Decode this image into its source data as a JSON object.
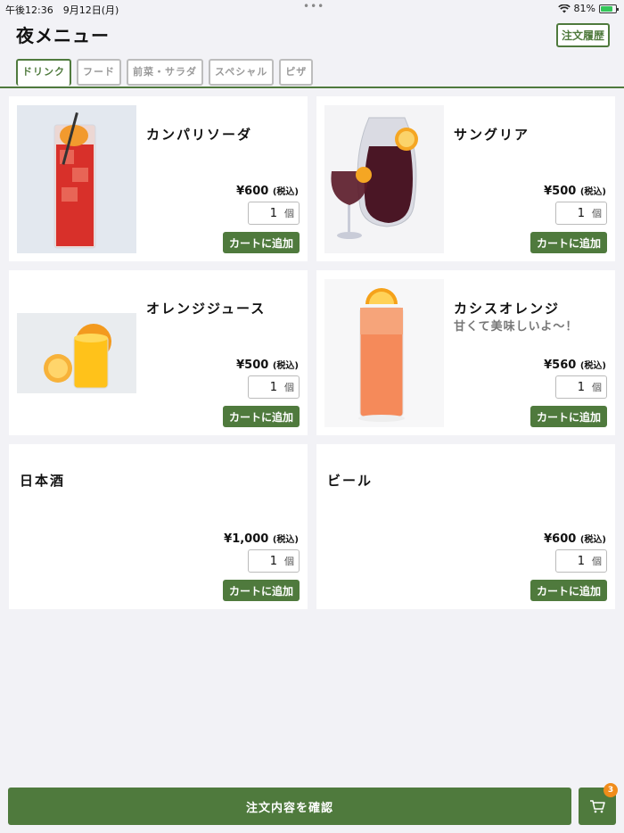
{
  "status_bar": {
    "time": "午後12:36　9月12日(月)",
    "battery": "81%",
    "dots": "•••"
  },
  "header": {
    "title": "夜メニュー",
    "history_label": "注文履歴"
  },
  "tabs": [
    {
      "label": "ドリンク",
      "active": true
    },
    {
      "label": "フード"
    },
    {
      "label": "前菜・サラダ"
    },
    {
      "label": "スペシャル"
    },
    {
      "label": "ピザ"
    }
  ],
  "items": [
    {
      "name": "カンパリソーダ",
      "desc": "",
      "price": "¥600",
      "tax": "(税込)",
      "qty": "1",
      "unit": "個",
      "add": "カートに追加",
      "image": "campari"
    },
    {
      "name": "サングリア",
      "desc": "",
      "price": "¥500",
      "tax": "(税込)",
      "qty": "1",
      "unit": "個",
      "add": "カートに追加",
      "image": "sangria"
    },
    {
      "name": "オレンジジュース",
      "desc": "",
      "price": "¥500",
      "tax": "(税込)",
      "qty": "1",
      "unit": "個",
      "add": "カートに追加",
      "image": "orange"
    },
    {
      "name": "カシスオレンジ",
      "desc": "甘くて美味しいよ〜！",
      "price": "¥560",
      "tax": "(税込)",
      "qty": "1",
      "unit": "個",
      "add": "カートに追加",
      "image": "cassis"
    },
    {
      "name": "日本酒",
      "desc": "",
      "price": "¥1,000",
      "tax": "(税込)",
      "qty": "1",
      "unit": "個",
      "add": "カートに追加",
      "image": ""
    },
    {
      "name": "ビール",
      "desc": "",
      "price": "¥600",
      "tax": "(税込)",
      "qty": "1",
      "unit": "個",
      "add": "カートに追加",
      "image": ""
    }
  ],
  "footer": {
    "confirm_label": "注文内容を確認",
    "cart_count": "3"
  },
  "colors": {
    "accent": "#4f7a3d",
    "badge": "#f08c1a"
  }
}
